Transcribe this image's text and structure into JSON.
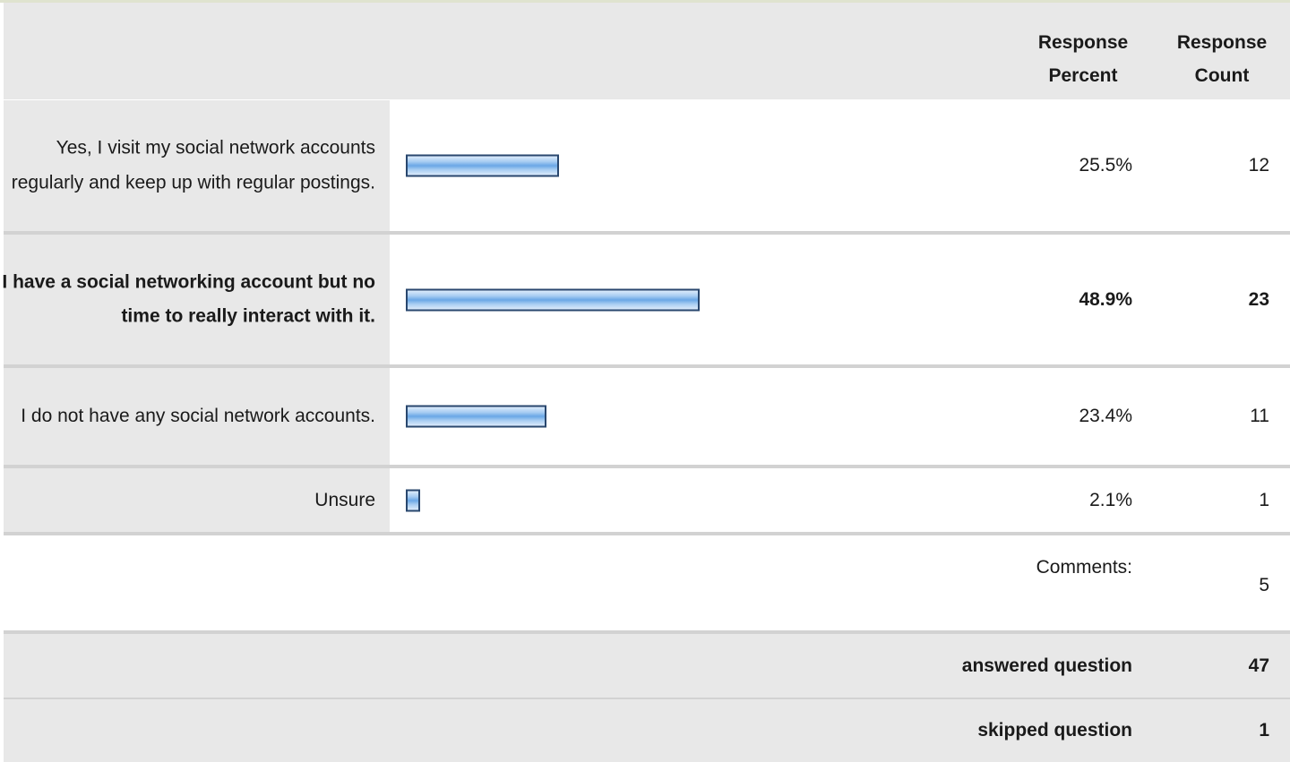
{
  "chart_data": {
    "type": "bar",
    "orientation": "horizontal",
    "columns": {
      "percent_label": "Response Percent",
      "count_label": "Response Count"
    },
    "categories": [
      "Yes, I visit my social network accounts regularly and keep up with regular postings.",
      "I have a social networking account but no time to really interact with it.",
      "I do not have any social network accounts.",
      "Unsure"
    ],
    "values": [
      25.5,
      48.9,
      23.4,
      2.1
    ],
    "percent_text": [
      "25.5%",
      "48.9%",
      "23.4%",
      "2.1%"
    ],
    "counts": [
      "12",
      "23",
      "11",
      "1"
    ],
    "highlighted_index": 1,
    "ylim": [
      0,
      100
    ],
    "bar_color": "#6aa7e6",
    "bar_border_color": "#29476e"
  },
  "comments": {
    "label": "Comments:",
    "count": "5"
  },
  "summary": {
    "answered_label": "answered question",
    "answered_value": "47",
    "skipped_label": "skipped question",
    "skipped_value": "1"
  }
}
